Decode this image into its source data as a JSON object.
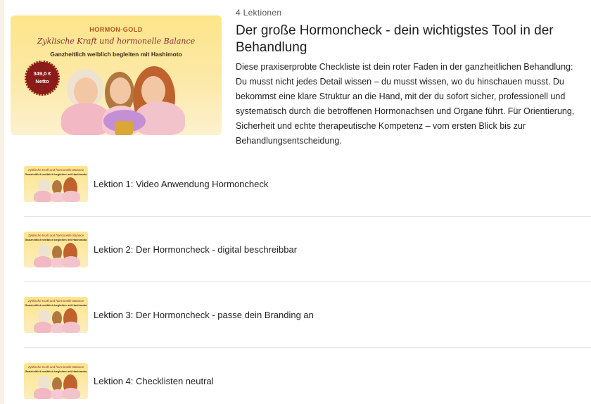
{
  "course": {
    "lesson_count": "4 Lektionen",
    "title": "Der große Hormoncheck - dein wichtigstes Tool in der Behandlung",
    "description": "Diese praxiserprobte Checkliste ist dein roter Faden in der ganzheitlichen Behandlung: Du musst nicht jedes Detail wissen – du musst wissen, wo du hinschauen musst. Du bekommst eine klare Struktur an die Hand, mit der du sofort sicher, professionell und systematisch durch die betroffenen Hormonachsen und Organe führt. Für Orientierung, Sicherheit und echte therapeutische Kompetenz – vom ersten Blick bis zur Behandlungsentscheidung.",
    "thumbnail": {
      "brand": "HORMON-GOLD",
      "script": "Zyklische Kraft und hormonelle Balance",
      "subtitle": "Ganzheitlich weiblich begleiten mit Hashimoto",
      "price": "349,0 €",
      "price_note": "Netto"
    }
  },
  "lessons": [
    {
      "label": "Lektion 1:  Video Anwendung Hormoncheck"
    },
    {
      "label": "Lektion 2:  Der Hormoncheck - digital beschreibbar"
    },
    {
      "label": "Lektion 3:  Der Hormoncheck - passe dein Branding an"
    },
    {
      "label": "Lektion 4:  Checklisten neutral"
    }
  ],
  "colors": {
    "thumb_yellow": "#fde58a",
    "badge_red": "#8b1a1a",
    "brand_orange": "#b5511a"
  }
}
